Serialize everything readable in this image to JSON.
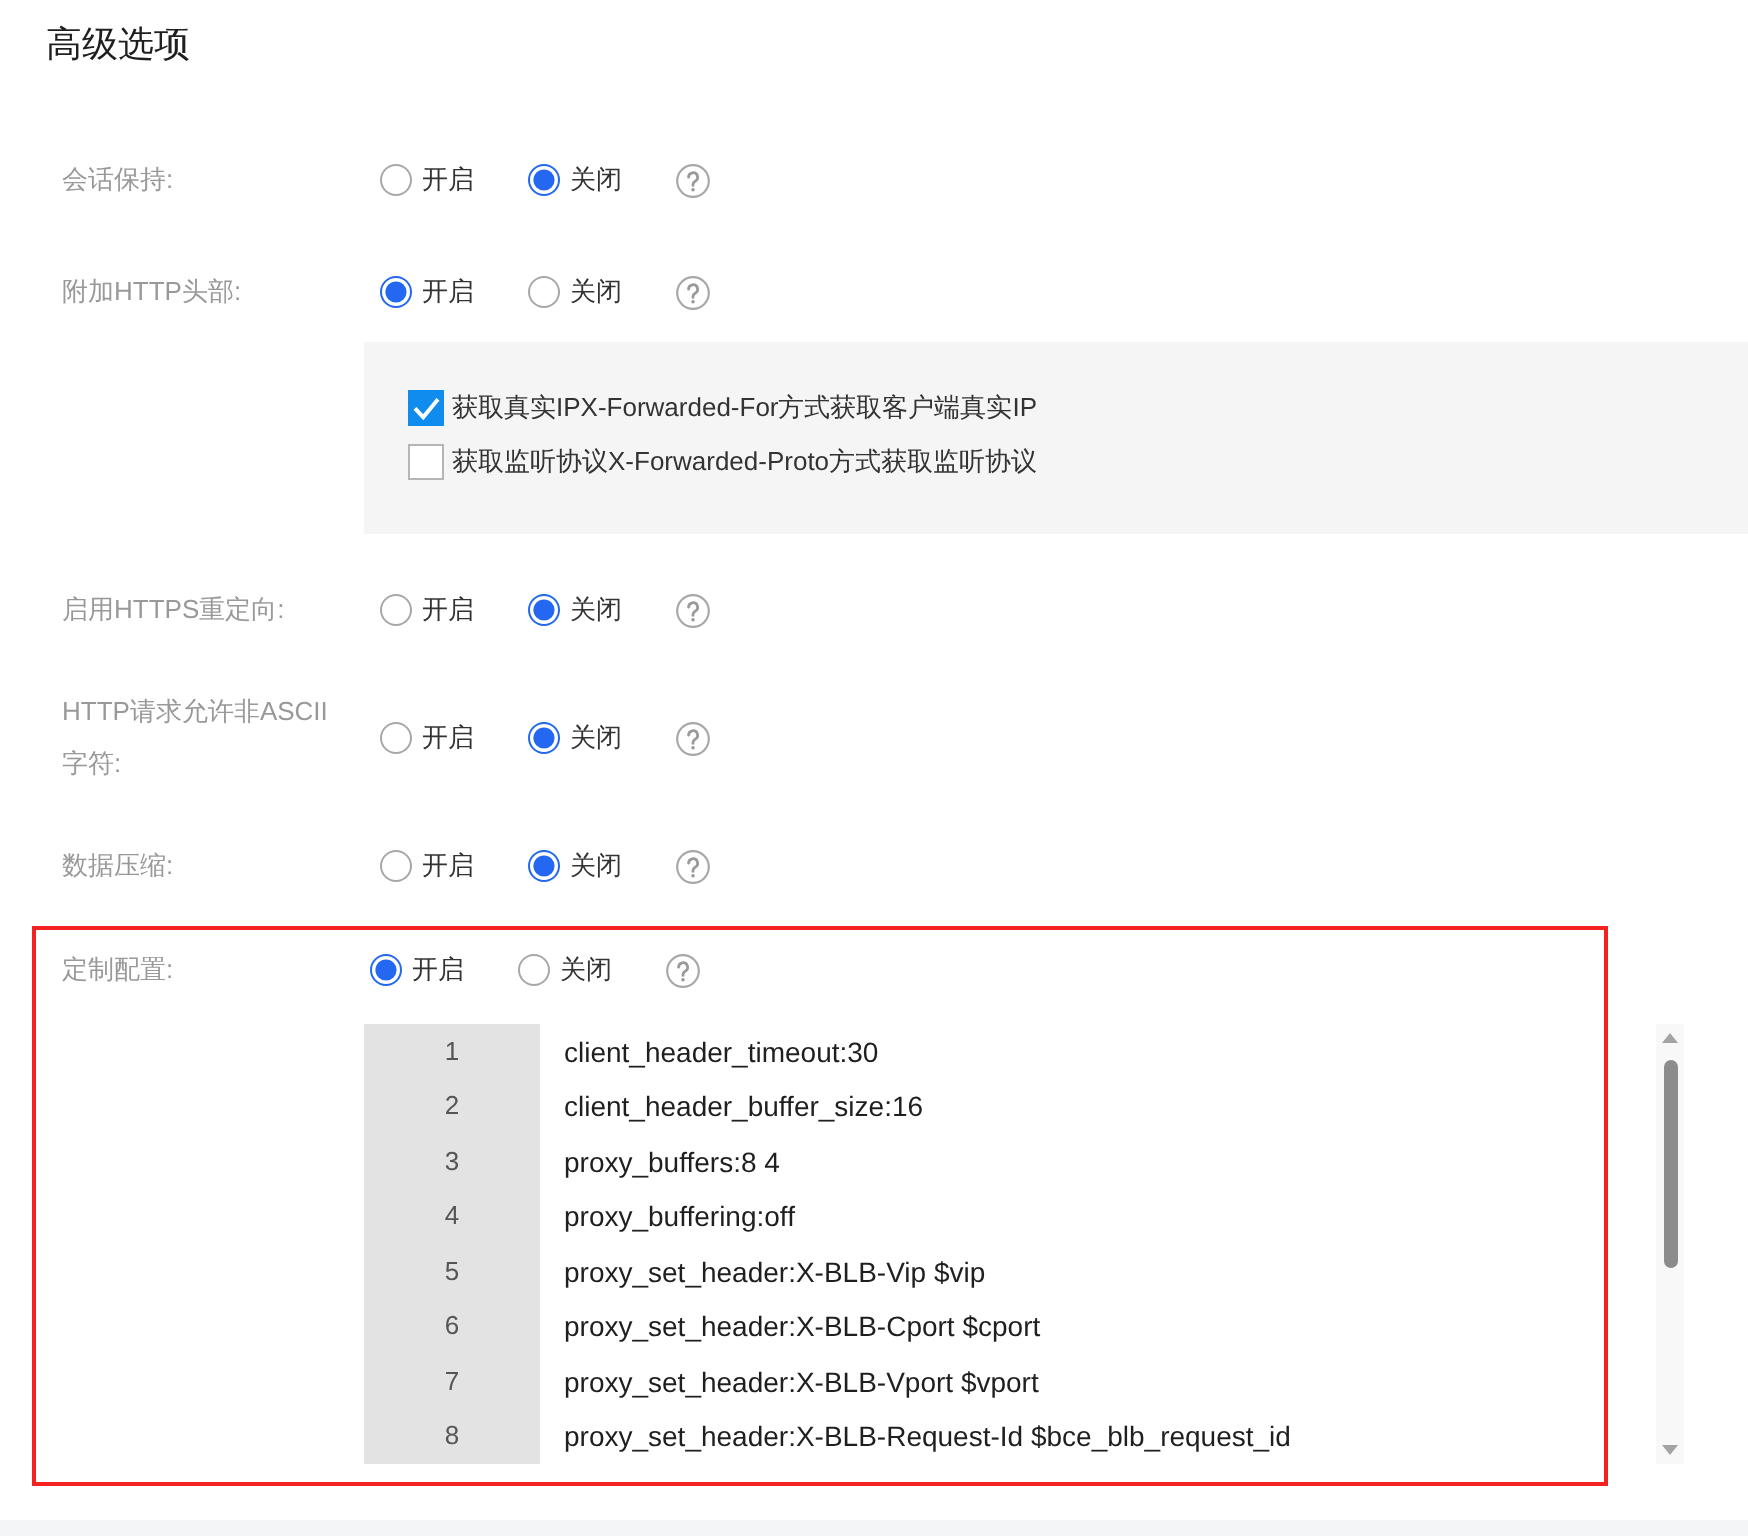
{
  "title": "高级选项",
  "settings": [
    {
      "label": "会话保持:",
      "options": [
        {
          "label": "开启",
          "selected": false
        },
        {
          "label": "关闭",
          "selected": true
        }
      ],
      "highlighted": false
    },
    {
      "label": "附加HTTP头部:",
      "options": [
        {
          "label": "开启",
          "selected": true
        },
        {
          "label": "关闭",
          "selected": false
        }
      ],
      "highlighted": false,
      "checkboxes": [
        {
          "label": "获取真实IPX-Forwarded-For方式获取客户端真实IP",
          "checked": true
        },
        {
          "label": "获取监听协议X-Forwarded-Proto方式获取监听协议",
          "checked": false
        }
      ]
    },
    {
      "label": "启用HTTPS重定向:",
      "options": [
        {
          "label": "开启",
          "selected": false
        },
        {
          "label": "关闭",
          "selected": true
        }
      ],
      "highlighted": false
    },
    {
      "label": "HTTP请求允许非ASCII字符:",
      "options": [
        {
          "label": "开启",
          "selected": false
        },
        {
          "label": "关闭",
          "selected": true
        }
      ],
      "highlighted": false
    },
    {
      "label": "数据压缩:",
      "options": [
        {
          "label": "开启",
          "selected": false
        },
        {
          "label": "关闭",
          "selected": true
        }
      ],
      "highlighted": false
    },
    {
      "label": "定制配置:",
      "options": [
        {
          "label": "开启",
          "selected": true
        },
        {
          "label": "关闭",
          "selected": false
        }
      ],
      "highlighted": true,
      "editor": {
        "lines": [
          {
            "number": "1",
            "text": "client_header_timeout:30"
          },
          {
            "number": "2",
            "text": "client_header_buffer_size:16"
          },
          {
            "number": "3",
            "text": "proxy_buffers:8 4"
          },
          {
            "number": "4",
            "text": "proxy_buffering:off"
          },
          {
            "number": "5",
            "text": "proxy_set_header:X-BLB-Vip $vip"
          },
          {
            "number": "6",
            "text": "proxy_set_header:X-BLB-Cport $cport"
          },
          {
            "number": "7",
            "text": "proxy_set_header:X-BLB-Vport $vport"
          },
          {
            "number": "8",
            "text": "proxy_set_header:X-BLB-Request-Id $bce_blb_request_id"
          }
        ]
      }
    }
  ]
}
